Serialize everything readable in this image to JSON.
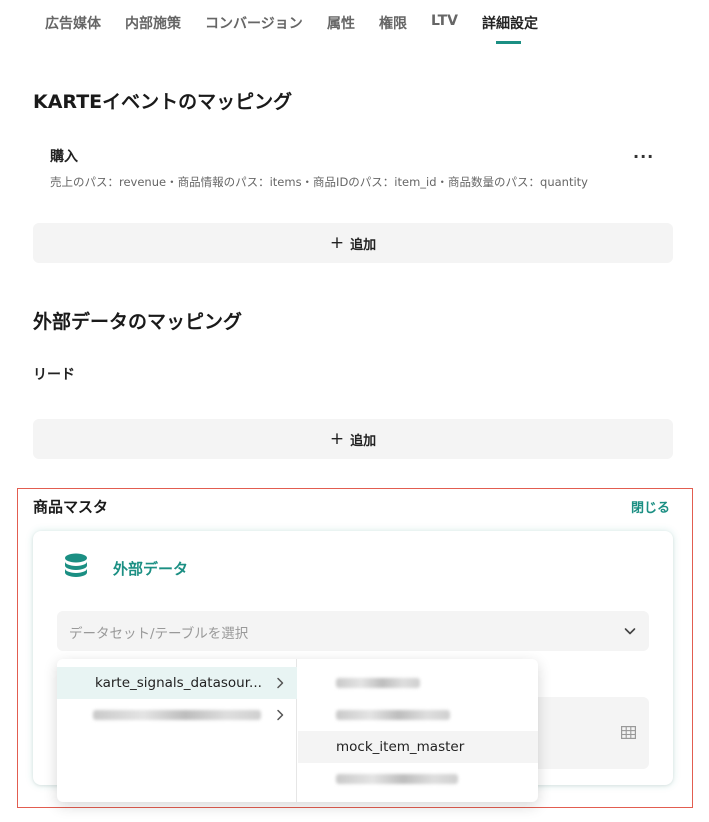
{
  "tabs": [
    "広告媒体",
    "内部施策",
    "コンバージョン",
    "属性",
    "権限",
    "LTV",
    "詳細設定"
  ],
  "active_tab": "詳細設定",
  "karte_section": {
    "title": "KARTEイベントのマッピング",
    "item_title": "購入",
    "item_desc": "売上のパス：revenue・商品情報のパス：items・商品IDのパス：item_id・商品数量のパス：quantity",
    "more_label": "···",
    "add_label": "追加"
  },
  "external_section": {
    "title": "外部データのマッピング",
    "item_title": "リード",
    "add_label": "追加"
  },
  "product_master": {
    "title": "商品マスタ",
    "close_label": "閉じる",
    "card_title": "外部データ",
    "select_placeholder": "データセット/テーブルを選択",
    "datasets": [
      {
        "label": "karte_signals_datasour...",
        "selected": true
      },
      {
        "label": "",
        "redacted": true
      }
    ],
    "tables": [
      {
        "label": "",
        "redacted": true
      },
      {
        "label": "",
        "redacted": true
      },
      {
        "label": "mock_item_master",
        "hover": true
      },
      {
        "label": "",
        "redacted": true
      }
    ]
  },
  "colors": {
    "accent": "#1b8f83",
    "highlight_border": "#e25d50",
    "field_bg": "#f4f4f4",
    "selected_row_bg": "#e8f4f3"
  },
  "icons": {
    "more": "more-horizontal-icon",
    "add": "plus-icon",
    "card": "database-icon",
    "select": "chevron-down-icon",
    "submenu": "chevron-right-icon",
    "field": "table-grid-icon"
  }
}
